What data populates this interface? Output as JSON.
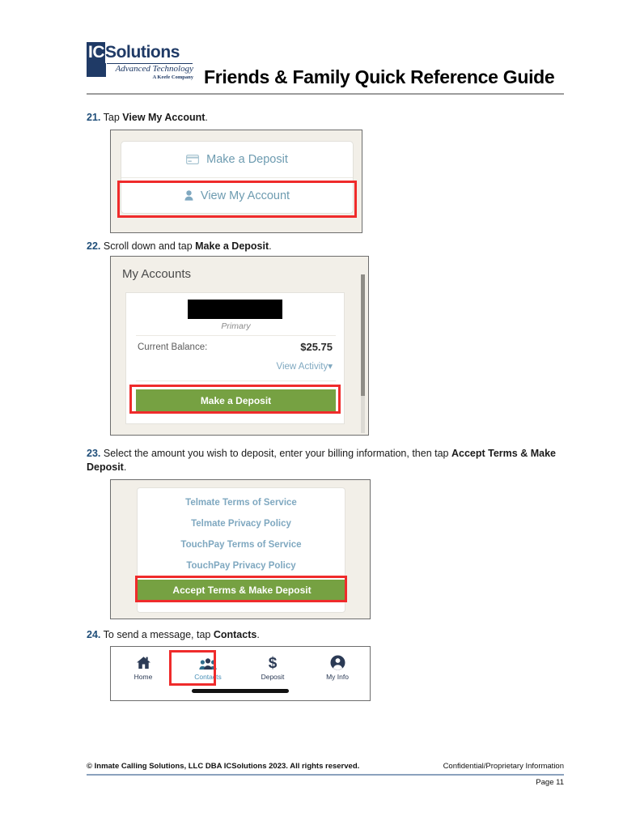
{
  "header": {
    "logo": {
      "ic": "IC",
      "solutions": "Solutions",
      "tagline": "Advanced Technology",
      "subtagline": "A Keefe Company"
    },
    "title": "Friends & Family Quick Reference Guide"
  },
  "steps": [
    {
      "number": "21.",
      "text_before": "Tap ",
      "bold": "View My Account",
      "text_after": "."
    },
    {
      "number": "22.",
      "text_before": "Scroll down and tap ",
      "bold": "Make a Deposit",
      "text_after": "."
    },
    {
      "number": "23.",
      "text_before": "Select the amount you wish to deposit, enter your billing information, then tap ",
      "bold": "Accept Terms & Make Deposit",
      "text_after": "."
    },
    {
      "number": "24.",
      "text_before": "To send a message, tap ",
      "bold": "Contacts",
      "text_after": "."
    }
  ],
  "panel_account_menu": {
    "make_deposit": "Make a Deposit",
    "view_my_account": "View My Account",
    "icons": {
      "make_deposit": "credit-card-icon",
      "view_my_account": "person-icon"
    }
  },
  "panel_my_accounts": {
    "title": "My Accounts",
    "account_name_redacted": "",
    "account_type": "Primary",
    "balance_label": "Current Balance:",
    "balance_value": "$25.75",
    "view_activity": "View Activity",
    "view_activity_caret": "▾",
    "deposit_button": "Make a Deposit"
  },
  "panel_terms": {
    "links": [
      "Telmate Terms of Service",
      "Telmate Privacy Policy",
      "TouchPay Terms of Service",
      "TouchPay Privacy Policy"
    ],
    "accept_button": "Accept Terms & Make Deposit"
  },
  "panel_navbar": {
    "items": [
      {
        "label": "Home",
        "icon": "home-icon",
        "active": false
      },
      {
        "label": "Contacts",
        "icon": "people-icon",
        "active": true
      },
      {
        "label": "Deposit",
        "icon": "dollar-icon",
        "active": false
      },
      {
        "label": "My Info",
        "icon": "person-circle-icon",
        "active": false
      }
    ]
  },
  "footer": {
    "copyright": "© Inmate Calling Solutions, LLC DBA ICSolutions 2023. All rights reserved.",
    "confidential": "Confidential/Proprietary Information",
    "page": "Page 11"
  },
  "colors": {
    "brand_navy": "#1f3a66",
    "highlight_red": "#ef2b2b",
    "button_green": "#76a142",
    "link_blue": "#7fa8c0",
    "panel_beige": "#f2efe8"
  }
}
